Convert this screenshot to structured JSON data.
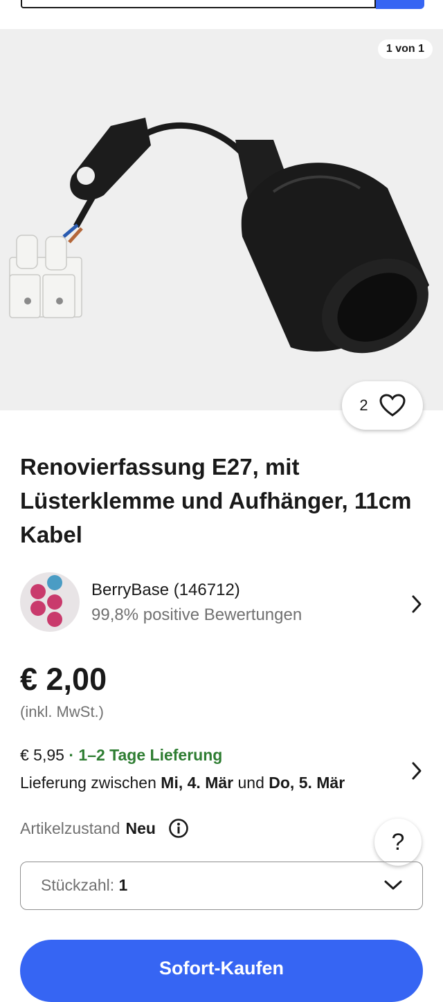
{
  "gallery": {
    "counter": "1 von 1",
    "image_alt": "Renovierfassung E27 mit Lüsterklemme"
  },
  "watch": {
    "count": "2"
  },
  "title": "Renovierfassung E27, mit Lüsterklemme und Aufhänger, 11cm Kabel",
  "seller": {
    "name": "BerryBase (146712)",
    "rating": "99,8% positive Bewertungen"
  },
  "price": {
    "amount": "€ 2,00",
    "vat_note": "(inkl. MwSt.)"
  },
  "shipping": {
    "cost": "€ 5,95",
    "separator": " · ",
    "speed": "1–2 Tage Lieferung",
    "range_prefix": "Lieferung zwischen ",
    "range_start": "Mi, 4. Mär",
    "range_mid": " und ",
    "range_end": "Do, 5. Mär"
  },
  "condition": {
    "label": "Artikelzustand",
    "value": "Neu"
  },
  "help": {
    "label": "?"
  },
  "quantity": {
    "label": "Stückzahl: ",
    "value": "1"
  },
  "buy": {
    "label": "Sofort-Kaufen"
  },
  "colors": {
    "accent": "#3665f3",
    "shipping_green": "#2e7d32",
    "muted": "#707070"
  }
}
